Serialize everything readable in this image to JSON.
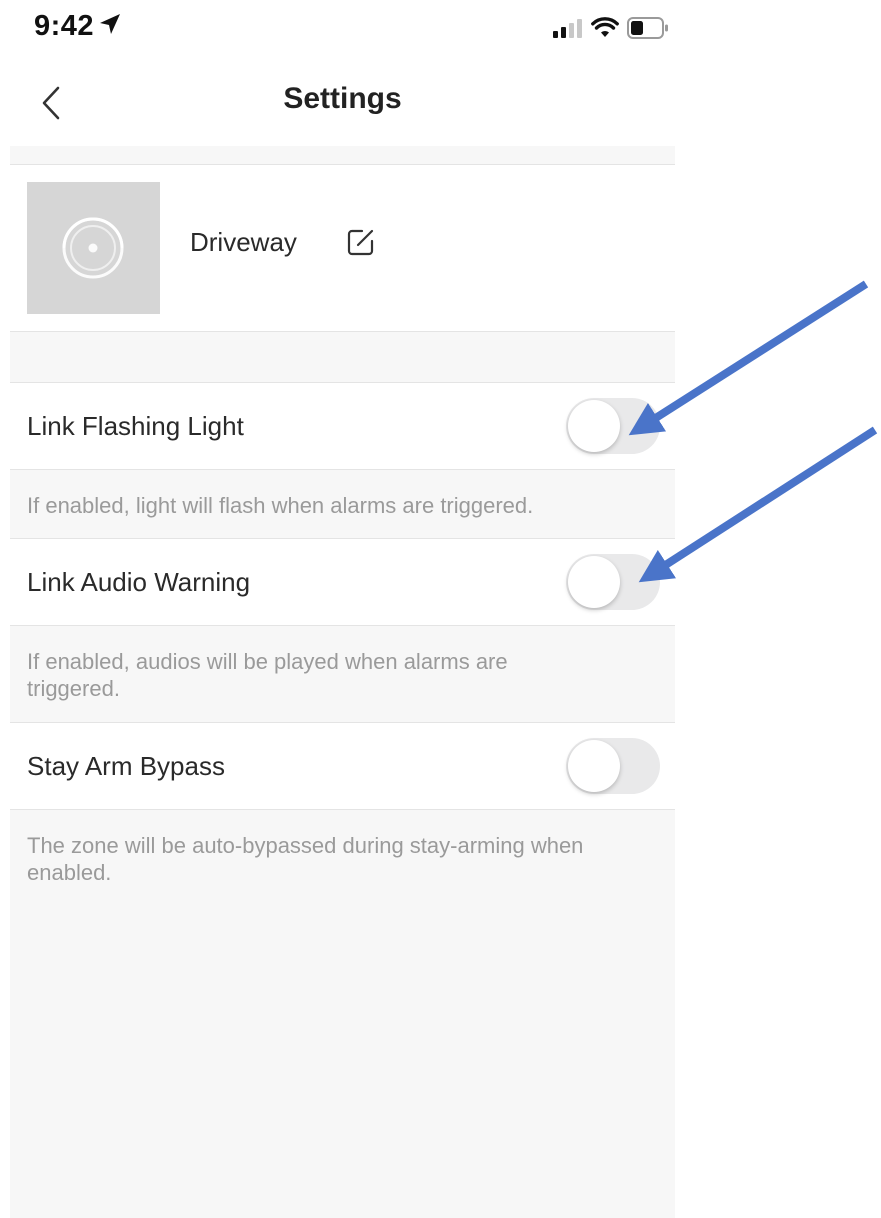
{
  "status_bar": {
    "time": "9:42",
    "icons": [
      "location-arrow-icon",
      "signal-icon",
      "wifi-icon",
      "battery-icon"
    ]
  },
  "nav": {
    "title": "Settings",
    "back_icon": "chevron-left-icon"
  },
  "device": {
    "name": "Driveway",
    "edit_icon": "edit-icon",
    "thumbnail_icon": "camera-lens-icon"
  },
  "settings": [
    {
      "label": "Link Flashing Light",
      "enabled": false,
      "description": "If enabled, light will flash when alarms are triggered."
    },
    {
      "label": "Link Audio Warning",
      "enabled": false,
      "description": "If enabled, audios will be played when alarms are triggered."
    },
    {
      "label": "Stay Arm Bypass",
      "enabled": false,
      "description": "The zone will be auto-bypassed during stay-arming when enabled."
    }
  ],
  "colors": {
    "background": "#f7f7f7",
    "row": "#ffffff",
    "toggle_off": "#e9e9ea",
    "description_text": "#9a9a9a",
    "annotation_arrow": "#4a74c9"
  }
}
